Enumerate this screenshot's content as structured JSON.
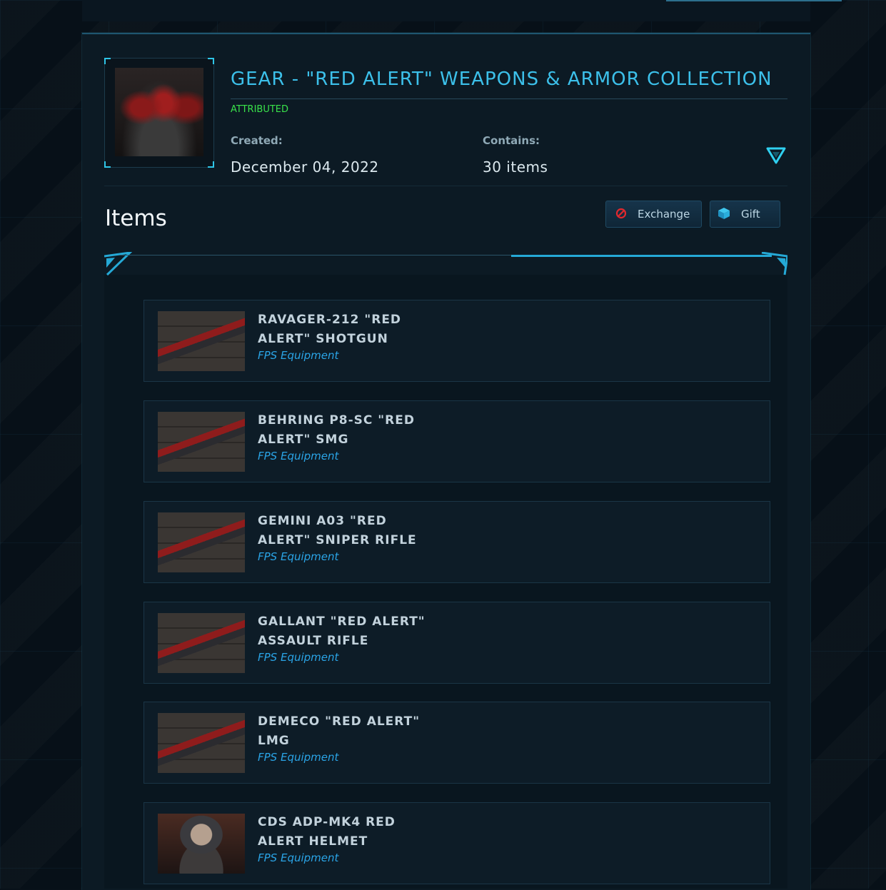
{
  "pledge": {
    "title": "GEAR - \"RED ALERT\" WEAPONS & ARMOR COLLECTION",
    "status": "ATTRIBUTED",
    "created_label": "Created:",
    "created_value": "December 04, 2022",
    "contains_label": "Contains:",
    "contains_value": "30 items"
  },
  "items_section": {
    "heading": "Items",
    "exchange_label": "Exchange",
    "gift_label": "Gift"
  },
  "items": [
    {
      "name": "RAVAGER-212 \"RED ALERT\" SHOTGUN",
      "type": "FPS Equipment"
    },
    {
      "name": "BEHRING P8-SC \"RED ALERT\" SMG",
      "type": "FPS Equipment"
    },
    {
      "name": "GEMINI A03 \"RED ALERT\" SNIPER RIFLE",
      "type": "FPS Equipment"
    },
    {
      "name": "GALLANT \"RED ALERT\" ASSAULT RIFLE",
      "type": "FPS Equipment"
    },
    {
      "name": "DEMECO \"RED ALERT\" LMG",
      "type": "FPS Equipment"
    },
    {
      "name": "CDS ADP-MK4 RED ALERT HELMET",
      "type": "FPS Equipment"
    }
  ],
  "colors": {
    "accent": "#3cc0ea",
    "status_green": "#39e24a",
    "item_type": "#2aa4e6",
    "exchange_icon": "#e0282e"
  },
  "icons": {
    "exchange": "no-entry-icon",
    "gift": "cube-icon",
    "toggle": "triangle-down-icon"
  }
}
